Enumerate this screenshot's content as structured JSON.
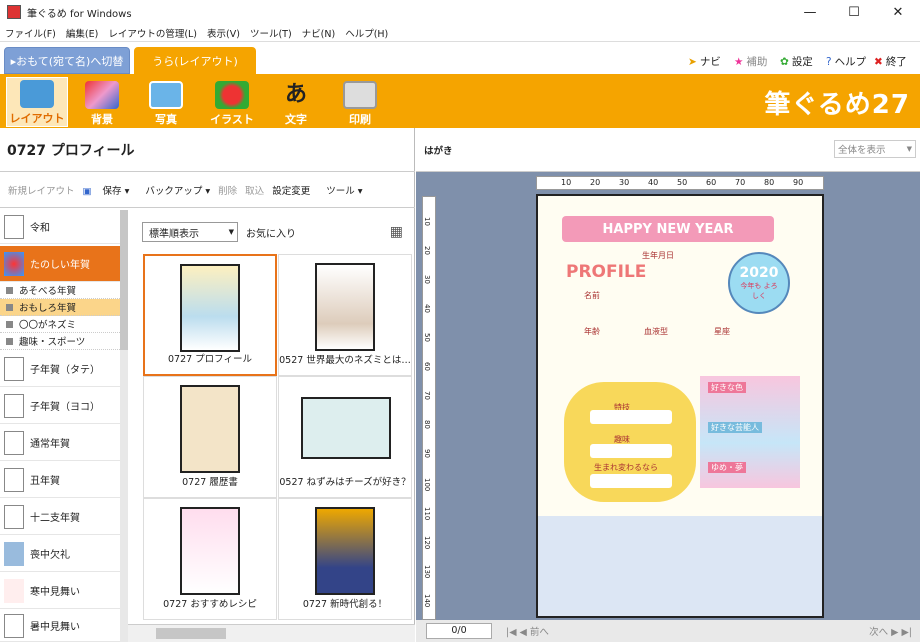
{
  "window": {
    "title": "筆ぐるめ for Windows",
    "minimize": "—",
    "maximize": "☐",
    "close": "✕"
  },
  "menu": [
    "ファイル(F)",
    "編集(E)",
    "レイアウトの管理(L)",
    "表示(V)",
    "ツール(T)",
    "ナビ(N)",
    "ヘルプ(H)"
  ],
  "tabs": {
    "front": "▸おもて(宛て名)へ切替",
    "back": "うら(レイアウト)"
  },
  "right_tools": {
    "navi": "ナビ",
    "assist": "補助",
    "settings": "設定",
    "help": "ヘルプ",
    "exit": "終了"
  },
  "ribbon": {
    "layout": "レイアウト",
    "background": "背景",
    "photo": "写真",
    "illust": "イラスト",
    "text": "文字",
    "print": "印刷",
    "brand": "筆ぐるめ27"
  },
  "panel": {
    "title": "0727 プロフィール",
    "tool_new": "新規レイアウト",
    "tool_save": "保存",
    "tool_backup": "バックアップ",
    "tool_delete": "削除",
    "tool_import": "取込",
    "tool_settings": "設定変更",
    "tool_tools": "ツール"
  },
  "categories": {
    "reiwa": "令和",
    "fun": "たのしい年賀",
    "ne_tate": "子年賀（タテ）",
    "ne_yoko": "子年賀（ヨコ）",
    "normal": "通常年賀",
    "ushi": "丑年賀",
    "eto": "十二支年賀",
    "mourning": "喪中欠礼",
    "winter": "寒中見舞い",
    "summer": "暑中見舞い"
  },
  "subcategories": {
    "s1": "あそべる年賀",
    "s2": "おもしろ年賀",
    "s3": "〇〇がネズミ",
    "s4": "趣味・スポーツ"
  },
  "grid": {
    "sort": "標準順表示",
    "favorites": "お気に入り",
    "items": {
      "i1": "0727 プロフィール",
      "i2": "0527 世界最大のネズミとは…",
      "i3": "0727 履歴書",
      "i4": "0527 ねずみはチーズが好き？",
      "i5": "0727 おすすめレシピ",
      "i6": "0727 新時代創る！"
    }
  },
  "preview": {
    "paper": "はがき",
    "zoom": "全体を表示",
    "page": "0/0",
    "prev": "前へ",
    "next": "次へ"
  },
  "card": {
    "heading": "HAPPY NEW YEAR",
    "profile": "PROFILE",
    "birthday": "生年月日",
    "name": "名前",
    "year": "2020",
    "greeting": "今年も よろしく",
    "age": "年齢",
    "blood": "血液型",
    "sign": "星座",
    "hobby_spec": "特技",
    "hobby": "趣味",
    "reborn": "生まれ変わるなら",
    "likes_color": "好きな色",
    "likes_person": "好きな芸能人",
    "dream": "ゆめ・夢"
  },
  "ruler": {
    "h": [
      "10",
      "20",
      "30",
      "40",
      "50",
      "60",
      "70",
      "80",
      "90"
    ],
    "v": [
      "10",
      "20",
      "30",
      "40",
      "50",
      "60",
      "70",
      "80",
      "90",
      "100",
      "110",
      "120",
      "130",
      "140"
    ]
  },
  "colors": {
    "accent": "#f5a400",
    "frontTab": "#7ea0d6",
    "bg": "#7f90ab",
    "selection": "#e8731a"
  }
}
